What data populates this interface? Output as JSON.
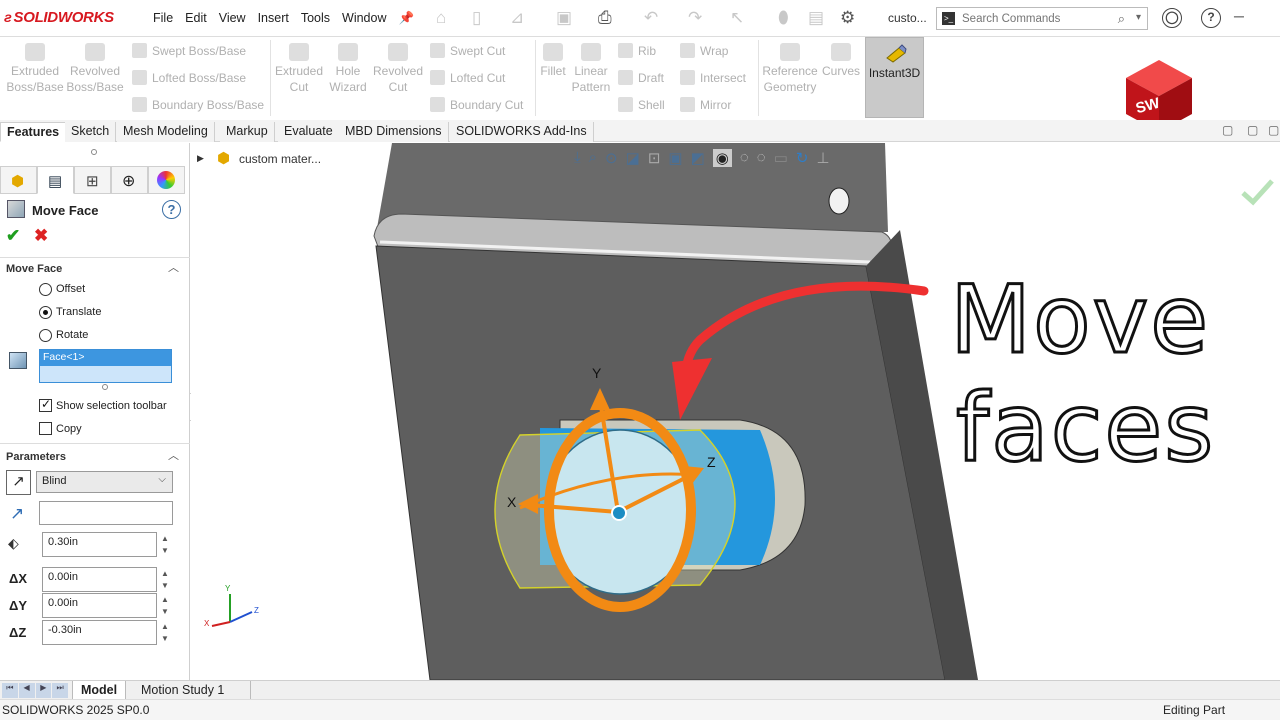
{
  "app": {
    "brand": "SOLIDWORKS",
    "document": "custo...",
    "version": "SOLIDWORKS 2025 SP0.0",
    "status": "Editing Part",
    "logo_letters": "SW"
  },
  "menu": [
    "File",
    "Edit",
    "View",
    "Insert",
    "Tools",
    "Window"
  ],
  "search": {
    "placeholder": "Search Commands"
  },
  "ribbon": {
    "extruded_boss": "Extruded Boss/Base",
    "revolved_boss": "Revolved Boss/Base",
    "swept_boss": "Swept Boss/Base",
    "lofted_boss": "Lofted Boss/Base",
    "boundary_boss": "Boundary Boss/Base",
    "extruded_cut": "Extruded Cut",
    "hole_wizard": "Hole Wizard",
    "revolved_cut": "Revolved Cut",
    "swept_cut": "Swept Cut",
    "lofted_cut": "Lofted Cut",
    "boundary_cut": "Boundary Cut",
    "fillet": "Fillet",
    "linear_pattern": "Linear Pattern",
    "rib": "Rib",
    "draft": "Draft",
    "shell": "Shell",
    "wrap": "Wrap",
    "intersect": "Intersect",
    "mirror": "Mirror",
    "reference_geometry": "Reference Geometry",
    "curves": "Curves",
    "instant3d": "Instant3D"
  },
  "tabs": [
    "Features",
    "Sketch",
    "Mesh Modeling",
    "Markup",
    "Evaluate",
    "MBD Dimensions",
    "SOLIDWORKS Add-Ins"
  ],
  "property_manager": {
    "title": "Move Face",
    "section_move_face": "Move Face",
    "options": [
      "Offset",
      "Translate",
      "Rotate"
    ],
    "selected_option": "Translate",
    "selection_item": "Face<1>",
    "show_selection_toolbar": "Show selection toolbar",
    "copy": "Copy",
    "section_parameters": "Parameters",
    "end_condition": "Blind",
    "distance": "0.30in",
    "dx_label": "ΔX",
    "dy_label": "ΔY",
    "dz_label": "ΔZ",
    "dx": "0.00in",
    "dy": "0.00in",
    "dz": "-0.30in"
  },
  "tree": {
    "root": "custom mater..."
  },
  "viewport": {
    "overlay_line1": "Move",
    "overlay_line2": "faces",
    "axis_x": "X",
    "axis_y": "Y",
    "axis_z": "Z",
    "triad_x": "X",
    "triad_y": "Y",
    "triad_z": "Z"
  },
  "bottom_tabs": [
    "Model",
    "Motion Study 1"
  ],
  "colors": {
    "brand_red": "#d71920",
    "plate": "#5d5d5d",
    "selected_face": "#1e9be0",
    "handle_orange": "#f28a14",
    "arrow_red": "#ee3030"
  }
}
